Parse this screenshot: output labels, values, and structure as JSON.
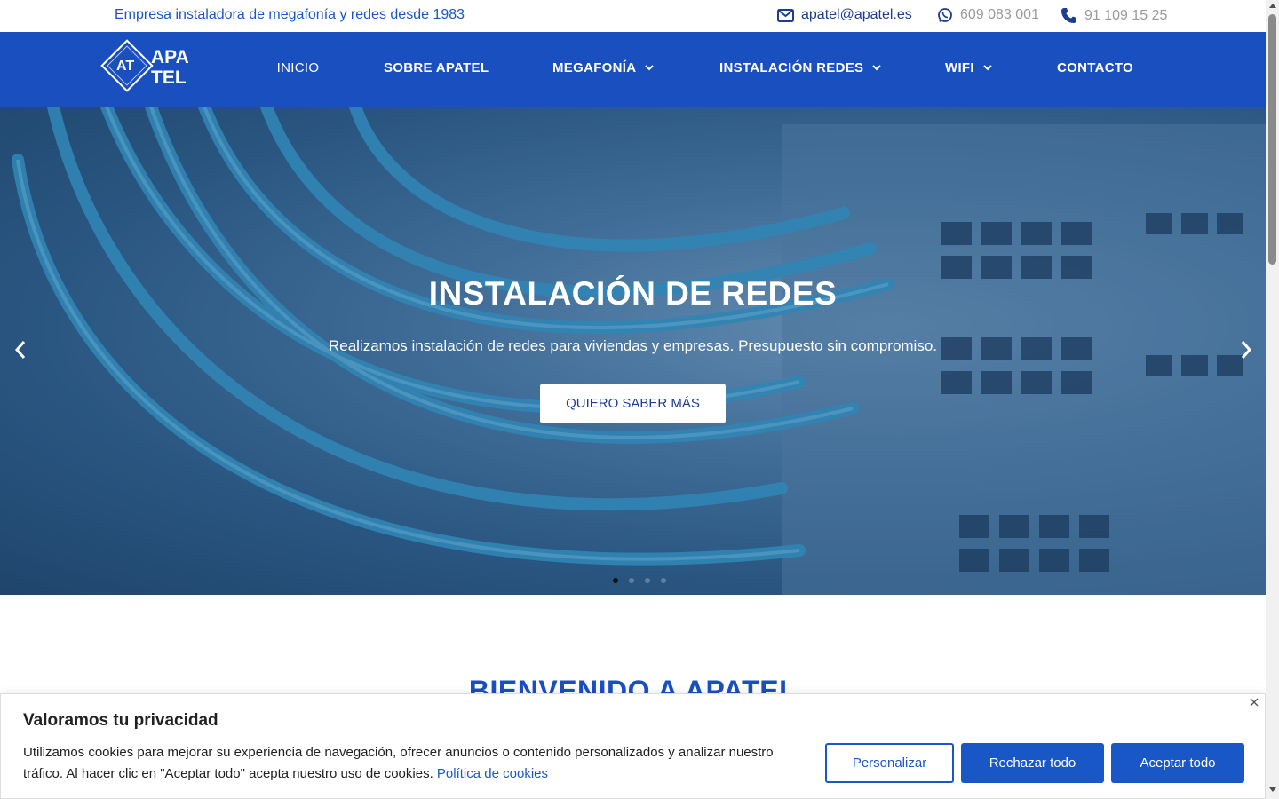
{
  "topbar": {
    "tagline": "Empresa instaladora de megafonía y redes desde 1983",
    "email": "apatel@apatel.es",
    "whatsapp": "609 083 001",
    "phone": "91 109 15 25"
  },
  "logo": {
    "mark": "AT",
    "line1": "APA",
    "line2": "TEL"
  },
  "nav": {
    "inicio": "INICIO",
    "sobre": "SOBRE APATEL",
    "megafonia": "MEGAFONÍA",
    "redes": "INSTALACIÓN REDES",
    "wifi": "WIFI",
    "contacto": "CONTACTO"
  },
  "hero": {
    "title": "INSTALACIÓN DE REDES",
    "subtitle": "Realizamos instalación de redes para viviendas y empresas. Presupuesto sin compromiso.",
    "button": "QUIERO SABER MÁS",
    "slide_count": 4,
    "active_slide": 1
  },
  "welcome": {
    "title": "BIENVENIDO A APATEL"
  },
  "cookie": {
    "title": "Valoramos tu privacidad",
    "text": "Utilizamos cookies para mejorar su experiencia de navegación, ofrecer anuncios o contenido personalizados y analizar nuestro tráfico. Al hacer clic en \"Aceptar todo\" acepta nuestro uso de cookies.",
    "link": "Política de cookies",
    "customize": "Personalizar",
    "reject": "Rechazar todo",
    "accept": "Aceptar todo"
  },
  "colors": {
    "brand_blue": "#1a4fbf",
    "button_blue": "#1a57c6",
    "text_dark": "#212121"
  },
  "icons": {
    "email": "envelope-icon",
    "whatsapp": "whatsapp-icon",
    "phone": "phone-icon",
    "chevron": "chevron-down-icon",
    "prev": "chevron-left-icon",
    "next": "chevron-right-icon",
    "close": "close-icon"
  }
}
